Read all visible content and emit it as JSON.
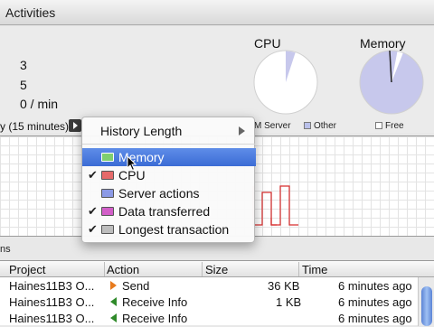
{
  "header": {
    "title": "Activities"
  },
  "stats": {
    "value1": "3",
    "value2": "5",
    "value3": "0 / min"
  },
  "pies": {
    "cpu": {
      "title": "CPU",
      "fraction": 0.05,
      "fill": "#ffffff",
      "slice": "#c7c8ec"
    },
    "memory": {
      "title": "Memory",
      "fraction": 0.97,
      "fill": "#c7c8ec",
      "slice": "#ffffff"
    }
  },
  "legend": {
    "server": "M Server",
    "other": "Other",
    "free": "Free",
    "other_color": "#b9c0ea",
    "free_color": "#ffffff"
  },
  "history": {
    "label": "y (15 minutes)"
  },
  "menu": {
    "header": "History Length",
    "items": [
      {
        "label": "Memory",
        "checked": false,
        "highlighted": true,
        "icon": "memory-icon",
        "icon_color": "#7fcf6f"
      },
      {
        "label": "CPU",
        "checked": true,
        "highlighted": false,
        "icon": "cpu-icon",
        "icon_color": "#e66a6a"
      },
      {
        "label": "Server actions",
        "checked": false,
        "highlighted": false,
        "icon": "server-actions-icon",
        "icon_color": "#8c9ae6"
      },
      {
        "label": "Data transferred",
        "checked": true,
        "highlighted": false,
        "icon": "data-transferred-icon",
        "icon_color": "#d25ec8"
      },
      {
        "label": "Longest transaction",
        "checked": true,
        "highlighted": false,
        "icon": "longest-transaction-icon",
        "icon_color": "#bdbdbd"
      }
    ]
  },
  "sessions": {
    "label": "ns"
  },
  "table": {
    "columns": [
      "Project",
      "Action",
      "Size",
      "Time"
    ],
    "rows": [
      {
        "project": "Haines11B3 O...",
        "action": "Send",
        "direction": "send",
        "size": "36 KB",
        "time": "6 minutes ago"
      },
      {
        "project": "Haines11B3 O...",
        "action": "Receive Info",
        "direction": "receive",
        "size": "1 KB",
        "time": "6 minutes ago"
      },
      {
        "project": "Haines11B3 O...",
        "action": "Receive Info",
        "direction": "receive",
        "size": "",
        "time": "6 minutes ago"
      }
    ]
  }
}
